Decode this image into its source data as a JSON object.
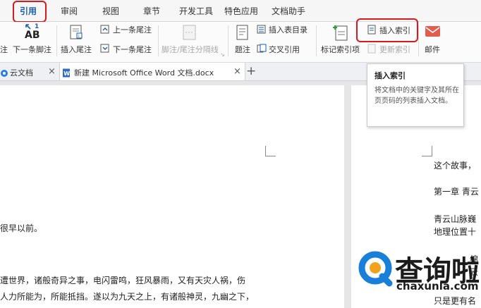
{
  "menubar": {
    "items": [
      "引用",
      "审阅",
      "视图",
      "章节",
      "开发工具",
      "特色应用",
      "文档助手"
    ],
    "active": "引用",
    "highlight_color": "#d9181f"
  },
  "ribbon": {
    "footnote_partial": "注",
    "next_footnote": "下一条脚注",
    "insert_endnote": "插入尾注",
    "prev_endnote": "上一条尾注",
    "next_endnote": "下一条尾注",
    "footnote_separator": "脚注/尾注分隔线",
    "caption": "题注",
    "insert_toc": "插入表目录",
    "cross_ref": "交叉引用",
    "mark_index": "标记索引项",
    "insert_index": "插入索引",
    "update_index": "更新索引",
    "mail": "邮件",
    "ab_badge": "AB",
    "ab_superscript": "1"
  },
  "tabs": {
    "cloud": "云文档",
    "document": "新建 Microsoft Office Word 文档.docx",
    "close_glyph": "×",
    "new_tab_glyph": "+"
  },
  "tooltip": {
    "title": "插入索引",
    "description": "将文档中的关键字及其所在页页码的列表插入文档。"
  },
  "document": {
    "left_page": [
      "很早以前。",
      "遭世界，诸般奇异之事，电闪雷鸣，狂风暴雨，又有天灾人祸，伤",
      "人力所能为，所能抵挡。遂以为九天之上，有诸般神灵，九幽之下，"
    ],
    "right_page": [
      "这个故事，",
      "第一章  青云",
      "青云山脉巍",
      "地理位置十",
      "只是更有名"
    ],
    "right_page_partial": [
      "绵",
      "云"
    ]
  },
  "watermark": {
    "brand": "查询啦",
    "domain": "chaxunla.com",
    "colors": {
      "blue": "#1a7fd8",
      "orange": "#f2a31b"
    }
  }
}
